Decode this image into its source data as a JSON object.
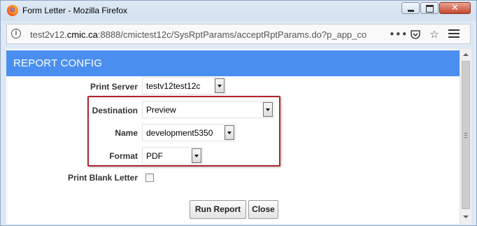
{
  "window": {
    "title": "Form Letter - Mozilla Firefox",
    "minimize_glyph": "",
    "close_glyph": "✕"
  },
  "addressbar": {
    "url_prefix": "test2v12.",
    "url_host": "cmic.ca",
    "url_rest": ":8888/cmictest12c/SysRptParams/acceptRptParams.do?p_app_co",
    "icons": [
      "info-icon",
      "more-actions-icon",
      "pocket-icon",
      "bookmark-star-icon",
      "hamburger-menu-icon"
    ]
  },
  "header": {
    "title": "REPORT CONFIG"
  },
  "form": {
    "print_server": {
      "label": "Print Server",
      "value": "testv12test12c"
    },
    "destination": {
      "label": "Destination",
      "value": "Preview"
    },
    "name": {
      "label": "Name",
      "value": "development5350"
    },
    "format": {
      "label": "Format",
      "value": "PDF"
    },
    "print_blank": {
      "label": "Print Blank Letter",
      "checked": false
    }
  },
  "buttons": {
    "run_report": "Run Report",
    "close": "Close"
  },
  "colors": {
    "header_band": "#4a8ff0",
    "highlight_border": "#b0262c"
  }
}
